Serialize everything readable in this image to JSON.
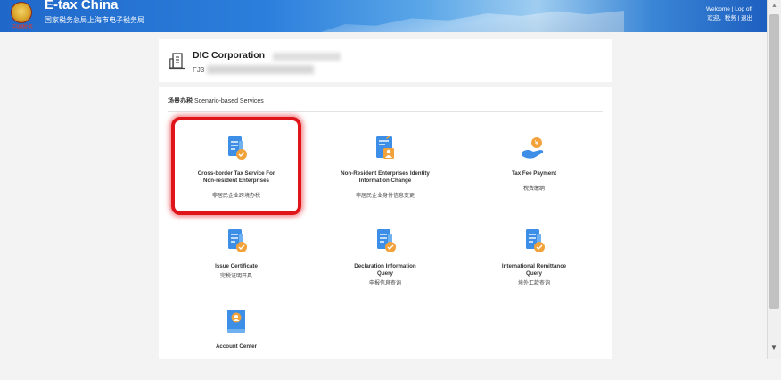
{
  "header": {
    "title": "E-tax China",
    "subtitle": "国家税务总局上海市电子税务局",
    "emblem_text": "中国税务",
    "welcome": "Welcome",
    "logout": "Log off",
    "cn_links": "欢迎，税务 | 退出"
  },
  "company": {
    "name": "DIC Corporation",
    "id_prefix": "FJ3"
  },
  "services": {
    "section_cn": "场景办税",
    "section_en": "Scenario-based Services",
    "tiles": [
      {
        "en1": "Cross-border Tax Service For",
        "en2": "Non-resident Enterprises",
        "cn": "非居民企业跨境办税",
        "icon": "document-badge-icon"
      },
      {
        "en1": "Non-Resident Enterprises Identity",
        "en2": "Information Change",
        "cn": "非居民企业身份信息变更",
        "icon": "document-person-icon"
      },
      {
        "en1": "Tax Fee Payment",
        "en2": "",
        "cn": "税费缴纳",
        "icon": "yuan-hand-icon"
      },
      {
        "en1": "Issue Certificate",
        "en2": "",
        "cn": "完税证明开具",
        "icon": "document-badge-icon"
      },
      {
        "en1": "Declaration Information",
        "en2": "Query",
        "cn": "申报信息查询",
        "icon": "document-badge-icon"
      },
      {
        "en1": "International Remittance",
        "en2": "Query",
        "cn": "境外汇款查询",
        "icon": "document-badge-icon"
      },
      {
        "en1": "Account Center",
        "en2": "",
        "cn": "",
        "icon": "account-book-icon"
      }
    ]
  },
  "colors": {
    "brand_blue": "#2c7fdc",
    "icon_blue": "#3d8ee6",
    "icon_orange": "#f2a23a",
    "highlight_red": "#e0151a"
  }
}
